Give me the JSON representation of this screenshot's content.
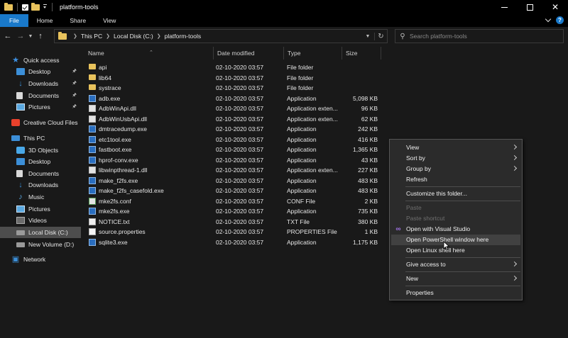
{
  "window": {
    "title": "platform-tools",
    "controls": {
      "minimize": "minimize",
      "maximize": "maximize",
      "close": "✕"
    }
  },
  "ribbon": {
    "tabs": [
      "File",
      "Home",
      "Share",
      "View"
    ],
    "help": "?"
  },
  "address": {
    "crumbs": [
      "This PC",
      "Local Disk (C:)",
      "platform-tools"
    ],
    "search_placeholder": "Search platform-tools"
  },
  "nav": {
    "items": [
      {
        "label": "Quick access",
        "icon": "star-icon"
      },
      {
        "label": "Desktop",
        "icon": "desktop-icon",
        "pinned": true
      },
      {
        "label": "Downloads",
        "icon": "download-icon",
        "pinned": true
      },
      {
        "label": "Documents",
        "icon": "documents-icon",
        "pinned": true
      },
      {
        "label": "Pictures",
        "icon": "pictures-icon",
        "pinned": true
      },
      {
        "label": "Creative Cloud Files",
        "icon": "creative-cloud-icon"
      },
      {
        "label": "This PC",
        "icon": "computer-icon"
      },
      {
        "label": "3D Objects",
        "icon": "3d-objects-icon"
      },
      {
        "label": "Desktop",
        "icon": "desktop-icon"
      },
      {
        "label": "Documents",
        "icon": "documents-icon"
      },
      {
        "label": "Downloads",
        "icon": "download-icon"
      },
      {
        "label": "Music",
        "icon": "music-icon"
      },
      {
        "label": "Pictures",
        "icon": "pictures-icon"
      },
      {
        "label": "Videos",
        "icon": "videos-icon"
      },
      {
        "label": "Local Disk (C:)",
        "icon": "disk-icon",
        "selected": true
      },
      {
        "label": "New Volume (D:)",
        "icon": "disk-icon"
      },
      {
        "label": "Network",
        "icon": "network-icon"
      }
    ]
  },
  "columns": {
    "name": "Name",
    "date": "Date modified",
    "type": "Type",
    "size": "Size"
  },
  "files": [
    {
      "name": "api",
      "date": "02-10-2020 03:57",
      "type": "File folder",
      "size": "",
      "kind": "folder"
    },
    {
      "name": "lib64",
      "date": "02-10-2020 03:57",
      "type": "File folder",
      "size": "",
      "kind": "folder"
    },
    {
      "name": "systrace",
      "date": "02-10-2020 03:57",
      "type": "File folder",
      "size": "",
      "kind": "folder"
    },
    {
      "name": "adb.exe",
      "date": "02-10-2020 03:57",
      "type": "Application",
      "size": "5,098 KB",
      "kind": "app"
    },
    {
      "name": "AdbWinApi.dll",
      "date": "02-10-2020 03:57",
      "type": "Application exten...",
      "size": "96 KB",
      "kind": "dll"
    },
    {
      "name": "AdbWinUsbApi.dll",
      "date": "02-10-2020 03:57",
      "type": "Application exten...",
      "size": "62 KB",
      "kind": "dll"
    },
    {
      "name": "dmtracedump.exe",
      "date": "02-10-2020 03:57",
      "type": "Application",
      "size": "242 KB",
      "kind": "app"
    },
    {
      "name": "etc1tool.exe",
      "date": "02-10-2020 03:57",
      "type": "Application",
      "size": "416 KB",
      "kind": "app"
    },
    {
      "name": "fastboot.exe",
      "date": "02-10-2020 03:57",
      "type": "Application",
      "size": "1,365 KB",
      "kind": "app"
    },
    {
      "name": "hprof-conv.exe",
      "date": "02-10-2020 03:57",
      "type": "Application",
      "size": "43 KB",
      "kind": "app"
    },
    {
      "name": "libwinpthread-1.dll",
      "date": "02-10-2020 03:57",
      "type": "Application exten...",
      "size": "227 KB",
      "kind": "dll"
    },
    {
      "name": "make_f2fs.exe",
      "date": "02-10-2020 03:57",
      "type": "Application",
      "size": "483 KB",
      "kind": "app"
    },
    {
      "name": "make_f2fs_casefold.exe",
      "date": "02-10-2020 03:57",
      "type": "Application",
      "size": "483 KB",
      "kind": "app"
    },
    {
      "name": "mke2fs.conf",
      "date": "02-10-2020 03:57",
      "type": "CONF File",
      "size": "2 KB",
      "kind": "conf"
    },
    {
      "name": "mke2fs.exe",
      "date": "02-10-2020 03:57",
      "type": "Application",
      "size": "735 KB",
      "kind": "app"
    },
    {
      "name": "NOTICE.txt",
      "date": "02-10-2020 03:57",
      "type": "TXT File",
      "size": "380 KB",
      "kind": "txt"
    },
    {
      "name": "source.properties",
      "date": "02-10-2020 03:57",
      "type": "PROPERTIES File",
      "size": "1 KB",
      "kind": "props"
    },
    {
      "name": "sqlite3.exe",
      "date": "02-10-2020 03:57",
      "type": "Application",
      "size": "1,175 KB",
      "kind": "app"
    }
  ],
  "context_menu": {
    "items": [
      {
        "label": "View",
        "submenu": true
      },
      {
        "label": "Sort by",
        "submenu": true
      },
      {
        "label": "Group by",
        "submenu": true
      },
      {
        "label": "Refresh"
      },
      {
        "sep": true
      },
      {
        "label": "Customize this folder..."
      },
      {
        "sep": true
      },
      {
        "label": "Paste",
        "disabled": true
      },
      {
        "label": "Paste shortcut",
        "disabled": true
      },
      {
        "label": "Open with Visual Studio",
        "icon": "visual-studio-icon"
      },
      {
        "label": "Open PowerShell window here",
        "hover": true
      },
      {
        "label": "Open Linux shell here"
      },
      {
        "sep": true
      },
      {
        "label": "Give access to",
        "submenu": true
      },
      {
        "sep": true
      },
      {
        "label": "New",
        "submenu": true
      },
      {
        "sep": true
      },
      {
        "label": "Properties"
      }
    ]
  }
}
